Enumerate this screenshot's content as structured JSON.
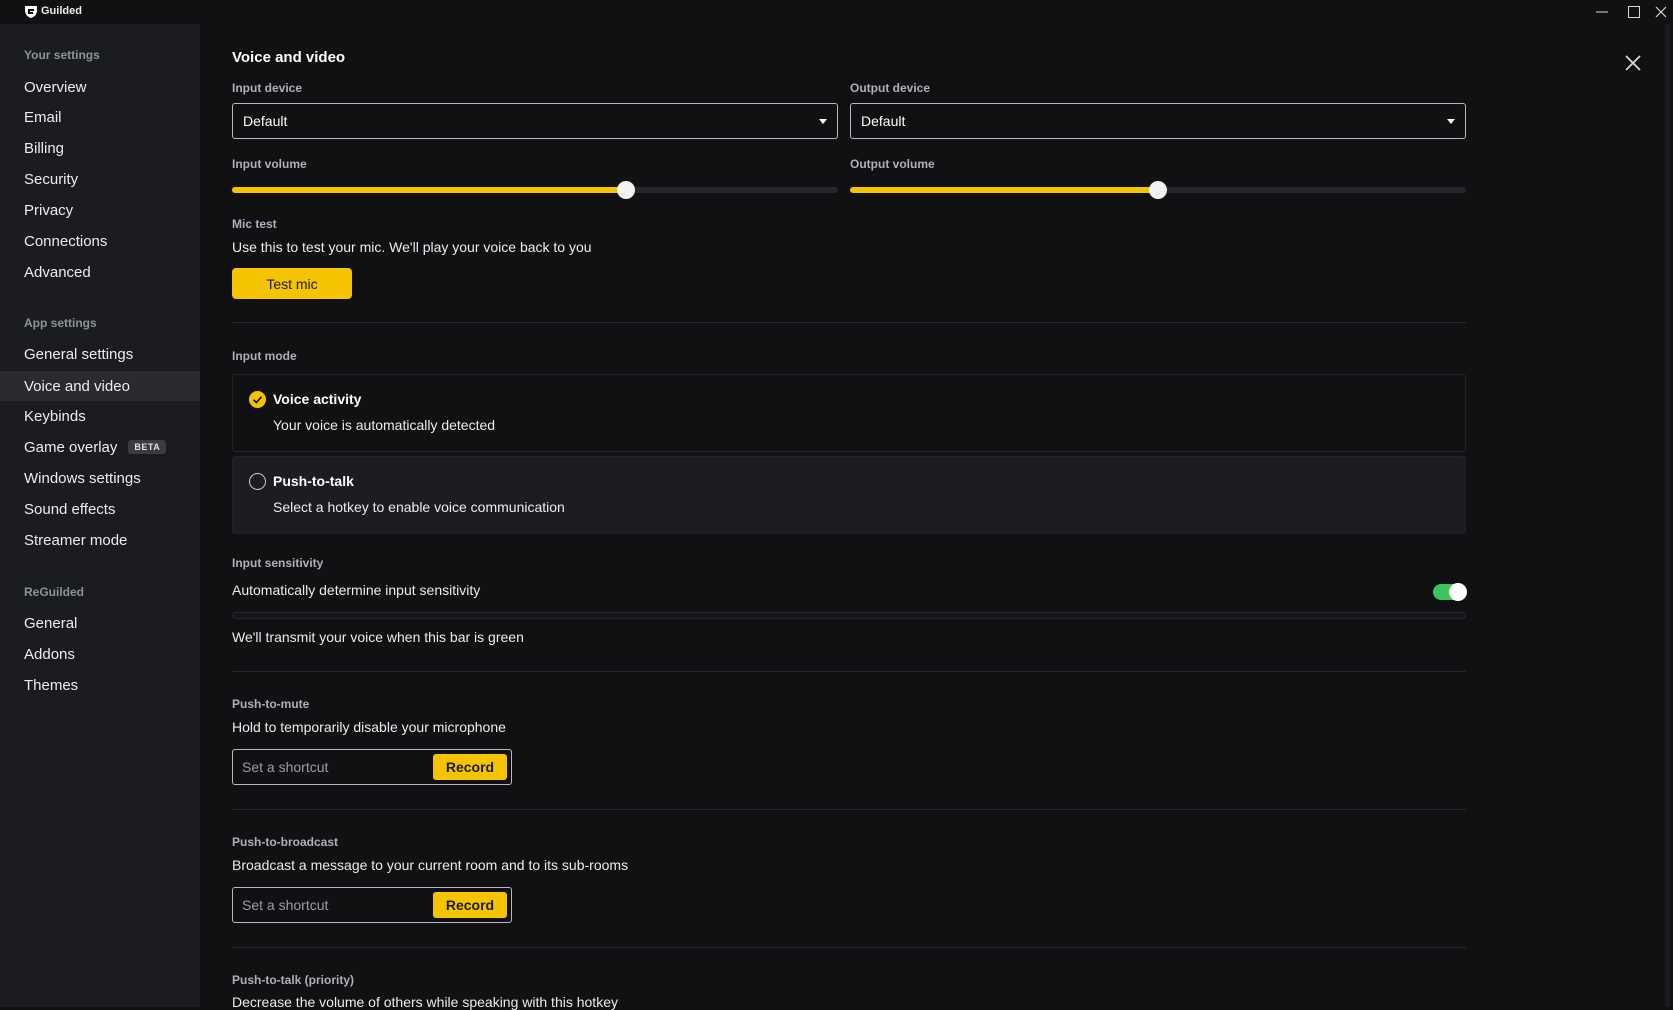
{
  "app": {
    "name": "Guilded"
  },
  "sidebar": {
    "your_settings_title": "Your settings",
    "your_settings": [
      "Overview",
      "Email",
      "Billing",
      "Security",
      "Privacy",
      "Connections",
      "Advanced"
    ],
    "app_settings_title": "App settings",
    "app_settings": [
      "General settings",
      "Voice and video",
      "Keybinds",
      "Game overlay",
      "Windows settings",
      "Sound effects",
      "Streamer mode"
    ],
    "beta_badge": "BETA",
    "active_item": "Voice and video",
    "reguilded_title": "ReGuilded",
    "reguilded": [
      "General",
      "Addons",
      "Themes"
    ]
  },
  "main": {
    "title": "Voice and video",
    "input_device": {
      "label": "Input device",
      "value": "Default"
    },
    "output_device": {
      "label": "Output device",
      "value": "Default"
    },
    "input_volume": {
      "label": "Input volume",
      "level": 0.65
    },
    "output_volume": {
      "label": "Output volume",
      "level": 0.5
    },
    "mic_test": {
      "label": "Mic test",
      "description": "Use this to test your mic. We'll play your voice back to you",
      "button": "Test mic"
    },
    "input_mode": {
      "label": "Input mode",
      "options": [
        {
          "title": "Voice activity",
          "description": "Your voice is automatically detected",
          "selected": true
        },
        {
          "title": "Push-to-talk",
          "description": "Select a hotkey to enable voice communication",
          "selected": false
        }
      ]
    },
    "input_sensitivity": {
      "label": "Input sensitivity",
      "auto_label": "Automatically determine input sensitivity",
      "auto_enabled": true,
      "hint": "We'll transmit your voice when this bar is green"
    },
    "push_to_mute": {
      "label": "Push-to-mute",
      "description": "Hold to temporarily disable your microphone",
      "placeholder": "Set a shortcut",
      "button": "Record"
    },
    "push_to_broadcast": {
      "label": "Push-to-broadcast",
      "description": "Broadcast a message to your current room and to its sub-rooms",
      "placeholder": "Set a shortcut",
      "button": "Record"
    },
    "push_to_talk_priority": {
      "label": "Push-to-talk (priority)",
      "description": "Decrease the volume of others while speaking with this hotkey"
    }
  },
  "colors": {
    "accent": "#f5c400",
    "toggle_on": "#3ec45c",
    "sidebar_bg": "#1b1c1f",
    "main_bg": "#111114"
  }
}
